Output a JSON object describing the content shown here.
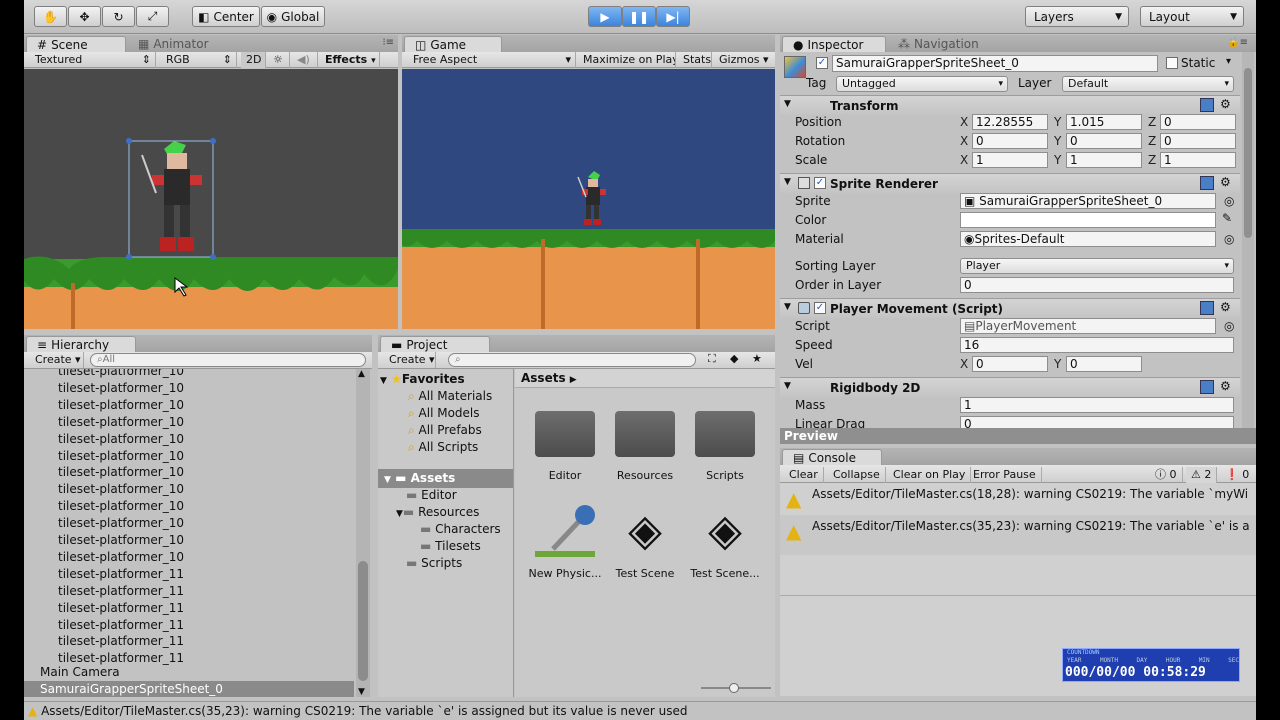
{
  "toolbar": {
    "pivot": "Center",
    "space": "Global",
    "layers": "Layers",
    "layout": "Layout"
  },
  "scene": {
    "tabs": [
      "Scene",
      "Animator"
    ],
    "shading": "Textured",
    "channel": "RGB",
    "mode2d": "2D",
    "effects": "Effects"
  },
  "game": {
    "tab": "Game",
    "aspect": "Free Aspect",
    "maximize": "Maximize on Play",
    "stats": "Stats",
    "gizmos": "Gizmos"
  },
  "inspector": {
    "tabs": [
      "Inspector",
      "Navigation"
    ],
    "object_name": "SamuraiGrapperSpriteSheet_0",
    "static_label": "Static",
    "tag_label": "Tag",
    "tag_value": "Untagged",
    "layer_label": "Layer",
    "layer_value": "Default",
    "transform": {
      "title": "Transform",
      "position_label": "Position",
      "rotation_label": "Rotation",
      "scale_label": "Scale",
      "position": [
        "12.28555",
        "1.015",
        "0"
      ],
      "rotation": [
        "0",
        "0",
        "0"
      ],
      "scale": [
        "1",
        "1",
        "1"
      ]
    },
    "axes": [
      "X",
      "Y",
      "Z"
    ],
    "sprite_renderer": {
      "title": "Sprite Renderer",
      "sprite_label": "Sprite",
      "sprite_value": "SamuraiGrapperSpriteSheet_0",
      "color_label": "Color",
      "material_label": "Material",
      "material_value": "Sprites-Default",
      "sorting_layer_label": "Sorting Layer",
      "sorting_layer_value": "Player",
      "order_label": "Order in Layer",
      "order_value": "0"
    },
    "player_movement": {
      "title": "Player Movement (Script)",
      "script_label": "Script",
      "script_value": "PlayerMovement",
      "speed_label": "Speed",
      "speed_value": "16",
      "vel_label": "Vel",
      "vel_x": "0",
      "vel_y": "0"
    },
    "rigidbody": {
      "title": "Rigidbody 2D",
      "mass_label": "Mass",
      "mass_value": "1",
      "drag_label": "Linear Drag",
      "drag_value": "0"
    },
    "preview": "Preview"
  },
  "hierarchy": {
    "tab": "Hierarchy",
    "create": "Create",
    "search_placeholder": "All",
    "items": [
      "tileset-platformer_10",
      "tileset-platformer_10",
      "tileset-platformer_10",
      "tileset-platformer_10",
      "tileset-platformer_10",
      "tileset-platformer_10",
      "tileset-platformer_10",
      "tileset-platformer_10",
      "tileset-platformer_10",
      "tileset-platformer_10",
      "tileset-platformer_10",
      "tileset-platformer_10",
      "tileset-platformer_11",
      "tileset-platformer_11",
      "tileset-platformer_11",
      "tileset-platformer_11",
      "tileset-platformer_11",
      "tileset-platformer_11"
    ],
    "main_camera": "Main Camera",
    "selected": "SamuraiGrapperSpriteSheet_0"
  },
  "project": {
    "tab": "Project",
    "create": "Create",
    "favorites": {
      "title": "Favorites",
      "items": [
        "All Materials",
        "All Models",
        "All Prefabs",
        "All Scripts"
      ]
    },
    "tree": {
      "assets": "Assets",
      "editor": "Editor",
      "resources": "Resources",
      "characters": "Characters",
      "tilesets": "Tilesets",
      "scripts": "Scripts"
    },
    "breadcrumb": "Assets",
    "grid": [
      "Editor",
      "Resources",
      "Scripts",
      "New Physic...",
      "Test Scene",
      "Test Scene..."
    ]
  },
  "console": {
    "tab": "Console",
    "buttons": [
      "Clear",
      "Collapse",
      "Clear on Play",
      "Error Pause"
    ],
    "counts": {
      "info": "0",
      "warn": "2",
      "error": "0"
    },
    "messages": [
      "Assets/Editor/TileMaster.cs(18,28): warning CS0219: The variable `myWi",
      "Assets/Editor/TileMaster.cs(35,23): warning CS0219: The variable `e' is a"
    ]
  },
  "countdown": {
    "title": "COUNTDOWN",
    "labels": [
      "YEAR",
      "MONTH",
      "DAY",
      "HOUR",
      "MIN",
      "SEC"
    ],
    "value": "000/00/00 00:58:29"
  },
  "status": "Assets/Editor/TileMaster.cs(35,23): warning CS0219: The variable `e' is assigned but its value is never used",
  "colors": {
    "game_sky": "#2f4880",
    "scene_bg": "#494949",
    "grass": "#3a9b2c",
    "dirt": "#e8944a",
    "selection": "#3d70c4"
  }
}
